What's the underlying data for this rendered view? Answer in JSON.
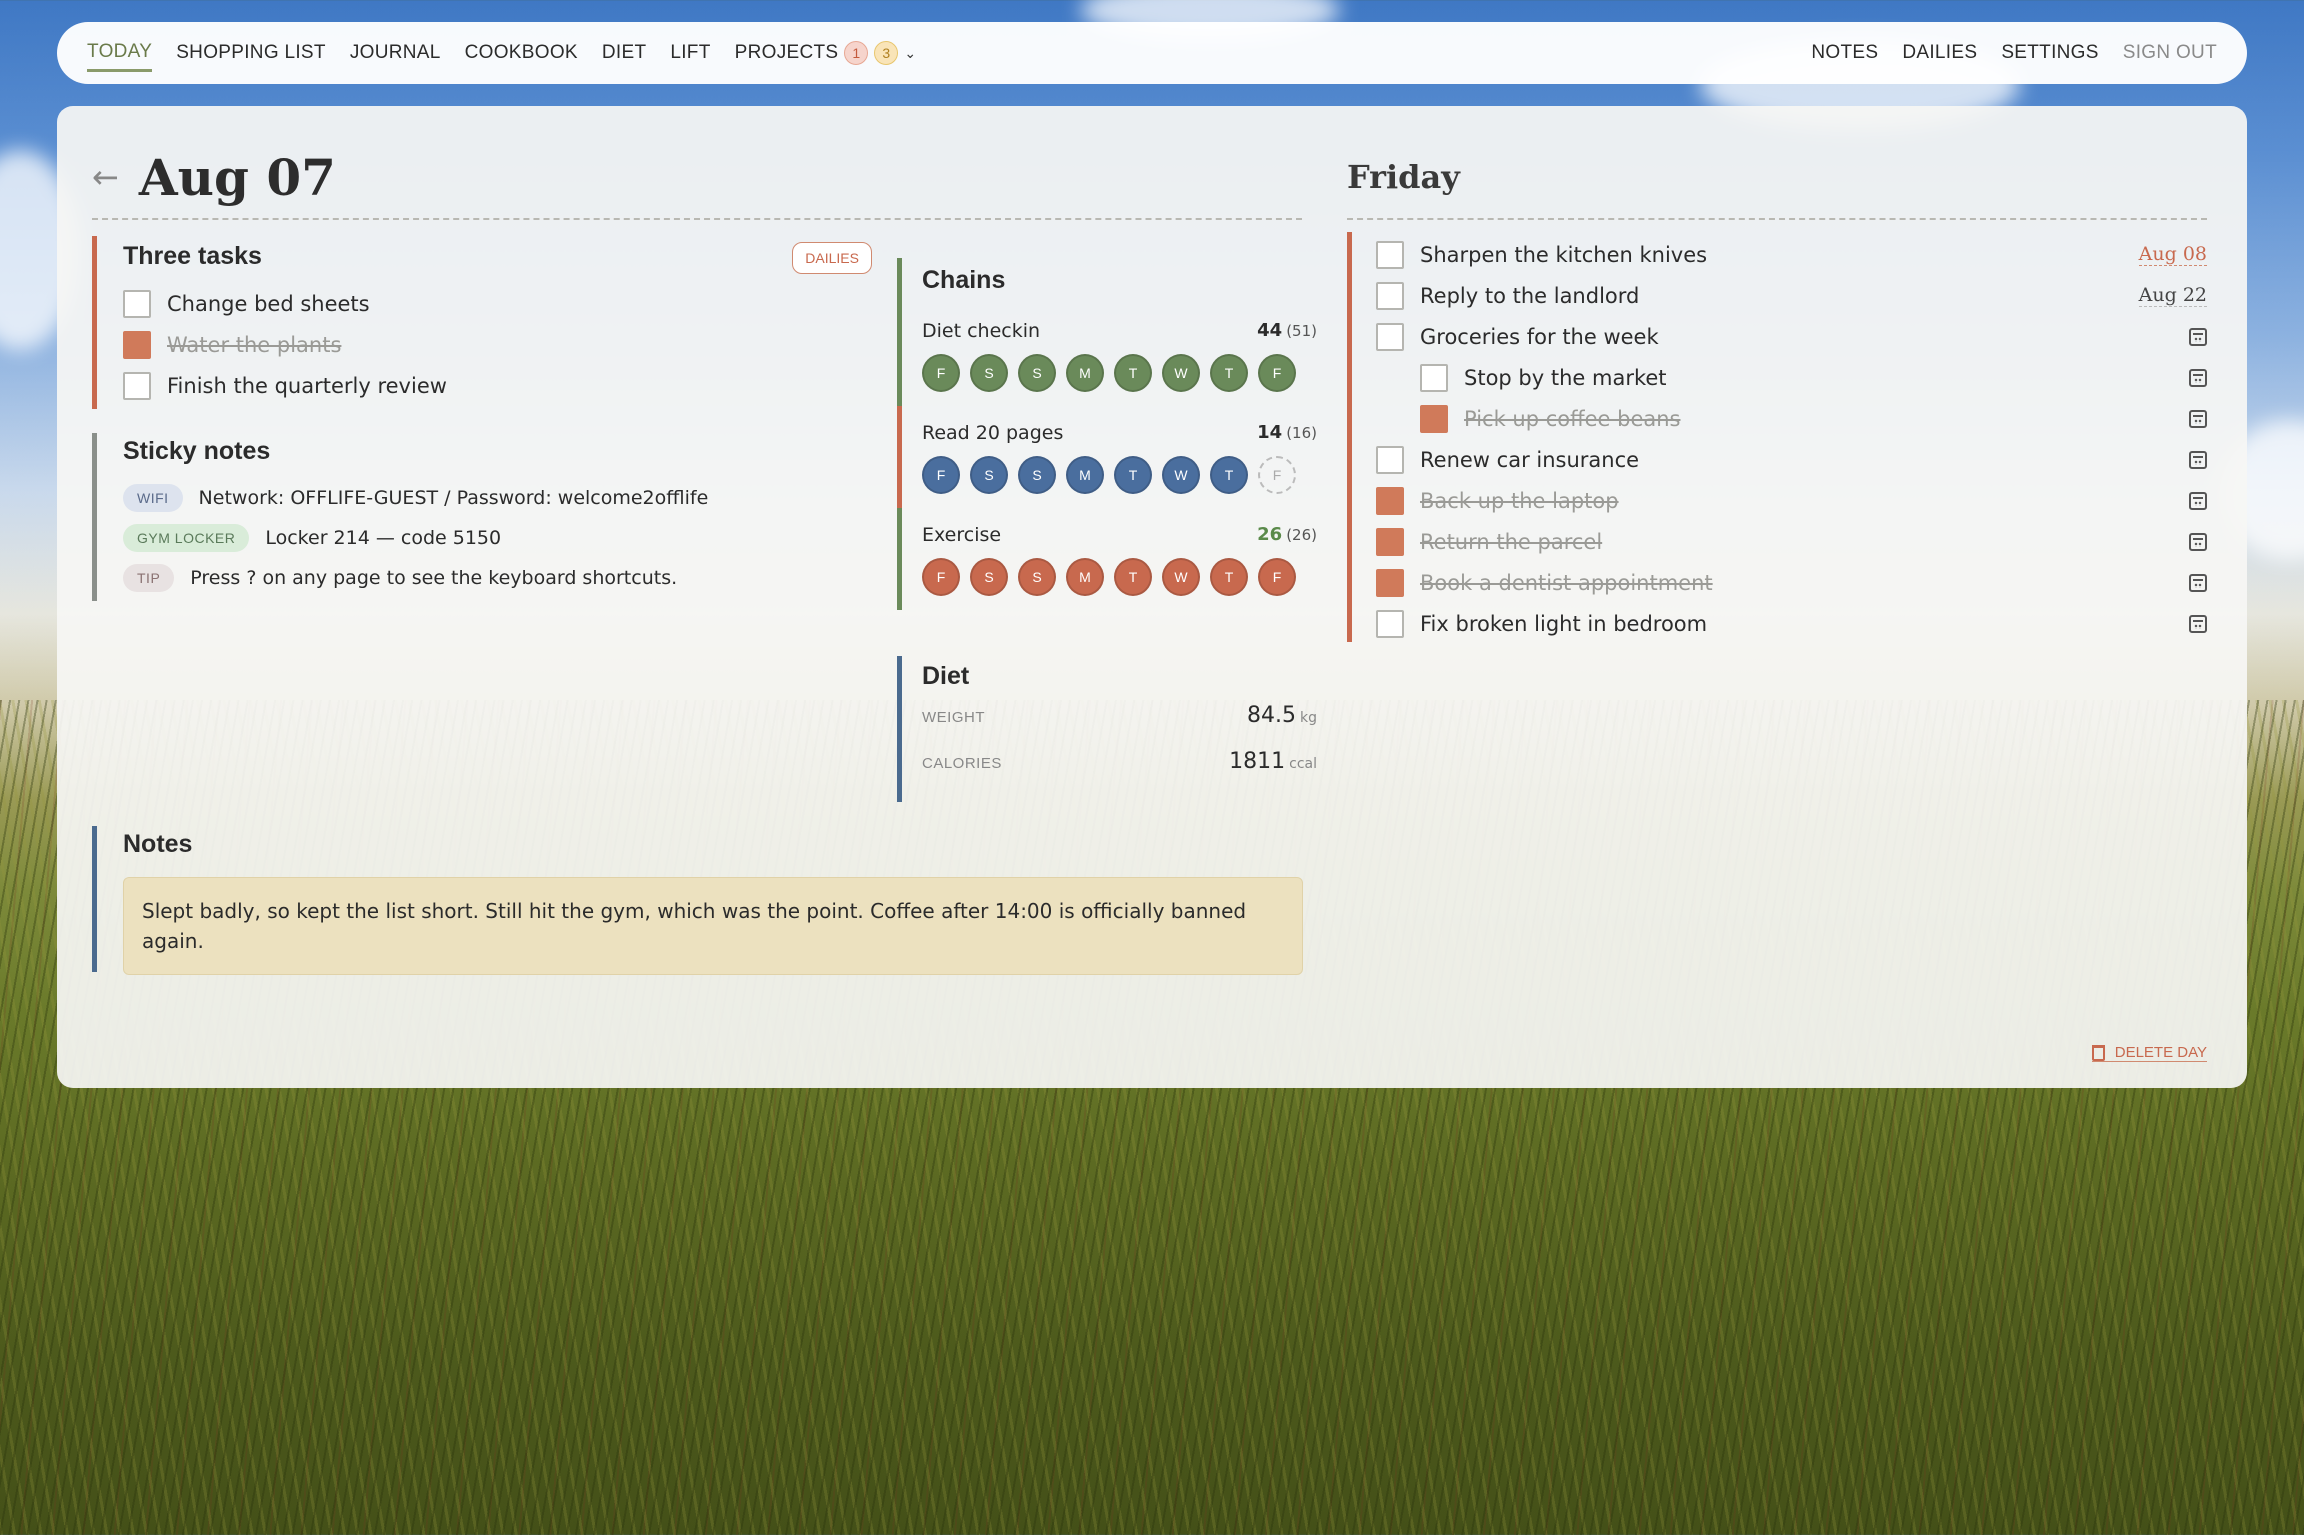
{
  "nav": {
    "left": [
      "TODAY",
      "SHOPPING LIST",
      "JOURNAL",
      "COOKBOOK",
      "DIET",
      "LIFT",
      "PROJECTS"
    ],
    "projects_badge_red": "1",
    "projects_badge_yellow": "3",
    "right": [
      "NOTES",
      "DAILIES",
      "SETTINGS",
      "SIGN OUT"
    ]
  },
  "day": {
    "back": "←",
    "title": "Aug 07",
    "weekday": "Friday"
  },
  "three_tasks": {
    "title": "Three tasks",
    "dailies_button": "DAILIES",
    "items": [
      {
        "label": "Change bed sheets",
        "done": false
      },
      {
        "label": "Water the plants",
        "done": true
      },
      {
        "label": "Finish the quarterly review",
        "done": false
      }
    ]
  },
  "sticky": {
    "title": "Sticky notes",
    "items": [
      {
        "tag": "WIFI",
        "text": "Network: OFFLIFE-GUEST / Password: welcome2offlife"
      },
      {
        "tag": "GYM LOCKER",
        "text": "Locker 214 — code 5150"
      },
      {
        "tag": "TIP",
        "text": "Press ? on any page to see the keyboard shortcuts."
      }
    ]
  },
  "chains": {
    "title": "Chains",
    "items": [
      {
        "name": "Diet checkin",
        "count": "44",
        "best": "(51)",
        "days": [
          "F",
          "S",
          "S",
          "M",
          "T",
          "W",
          "T",
          "F"
        ]
      },
      {
        "name": "Read 20 pages",
        "count": "14",
        "best": "(16)",
        "days": [
          "F",
          "S",
          "S",
          "M",
          "T",
          "W",
          "T",
          "F"
        ]
      },
      {
        "name": "Exercise",
        "count": "26",
        "best": "(26)",
        "days": [
          "F",
          "S",
          "S",
          "M",
          "T",
          "W",
          "T",
          "F"
        ]
      }
    ]
  },
  "diet": {
    "title": "Diet",
    "weight_label": "WEIGHT",
    "weight_value": "84.5",
    "weight_unit": "kg",
    "calories_label": "CALORIES",
    "calories_value": "1811",
    "calories_unit": "ccal"
  },
  "notes": {
    "title": "Notes",
    "text": "Slept badly, so kept the list short. Still hit the gym, which was the point. Coffee after 14:00 is officially banned again."
  },
  "friday": {
    "items": [
      {
        "label": "Sharpen the kitchen knives",
        "done": false,
        "due": "Aug 08"
      },
      {
        "label": "Reply to the landlord",
        "done": false,
        "due": "Aug 22"
      },
      {
        "label": "Groceries for the week",
        "done": false
      },
      {
        "label": "Stop by the market",
        "done": false
      },
      {
        "label": "Pick up coffee beans",
        "done": true
      },
      {
        "label": "Renew car insurance",
        "done": false
      },
      {
        "label": "Back up the laptop",
        "done": true
      },
      {
        "label": "Return the parcel",
        "done": true
      },
      {
        "label": "Book a dentist appointment",
        "done": true
      },
      {
        "label": "Fix broken light in bedroom",
        "done": false
      }
    ]
  },
  "delete_day": "DELETE DAY"
}
